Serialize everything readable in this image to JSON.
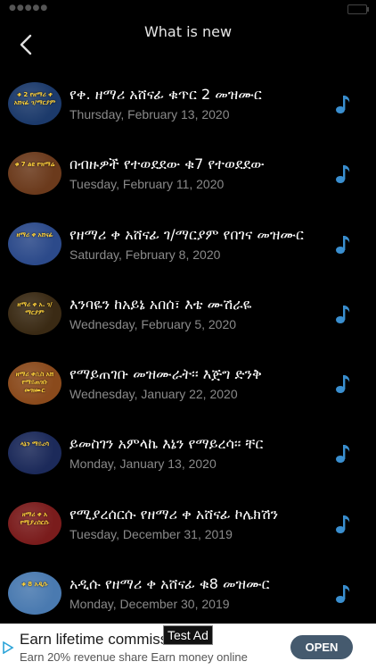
{
  "header": {
    "title": "What is new"
  },
  "items": [
    {
      "title": "የቀ. ዘማሪ አሸናፊ ቁጥር 2 መዝሙር",
      "date": "Thursday, February 13, 2020",
      "thumb_text": "ቁ 2 የዘማሪ ቀ አሸናፊ ገ/ማርያም",
      "thumb_bg": "#1c3a6b"
    },
    {
      "title": "በብዙዎች የተወደደው ቁ7 የተወደደው",
      "date": "Tuesday, February 11, 2020",
      "thumb_text": "ቁ 7 ልዩ የዝማሬ",
      "thumb_bg": "#6b3a1c"
    },
    {
      "title": "የዘማሪ ቀ አሸናፊ ገ/ማርያም የበገና መዝሙር",
      "date": "Saturday, February 8, 2020",
      "thumb_text": "ዘማሪ ቀ አሸናፊ",
      "thumb_bg": "#2c4a8a"
    },
    {
      "title": "እንባዬን ከአይኔ አበሰ፣ እቴ ሙሽራዬ",
      "date": "Wednesday, February 5, 2020",
      "thumb_text": "ዘማሪ ቀ አ. ገ/ማርያም",
      "thumb_bg": "#3a2a14"
    },
    {
      "title": "የማይጠገቡ መዝሙራት፡፡ እጅግ ድንቅ",
      "date": "Wednesday, January 22, 2020",
      "thumb_text": "ዘማሪ ቀሲስ አሸ የማይጠገቡ መዝሙር",
      "thumb_bg": "#8a4a1c"
    },
    {
      "title": "ይመስገን አምላኬ እኔን የማይረሳ፡፡ ቸር",
      "date": "Monday, January 13, 2020",
      "thumb_text": "ላኔን ማይረሳ",
      "thumb_bg": "#1c2a5a"
    },
    {
      "title": "የሚያረሰርሱ የዘማሪ ቀ አሸናፊ ኮሌክሽን",
      "date": "Tuesday, December 31, 2019",
      "thumb_text": "ዘማሪ ቀ አ የሚያረሰርሱ",
      "thumb_bg": "#7a1c1c"
    },
    {
      "title": "አዲሱ የዘማሪ ቀ አሸናፊ ቁ8 መዝሙር",
      "date": "Monday, December 30, 2019",
      "thumb_text": "ቁ 8 አዲሱ",
      "thumb_bg": "#4a7ab0"
    }
  ],
  "ad": {
    "headline": "Earn lifetime commiss",
    "badge": "Test Ad",
    "body": "Earn 20% revenue share Earn money online",
    "cta": "OPEN"
  },
  "colors": {
    "background": "#000000",
    "accent_icon": "#3a8fd0",
    "date_text": "#8a8a8a",
    "open_button": "#455a6e"
  },
  "icons": {
    "back": "chevron-left-icon",
    "item": "music-note-icon",
    "ad": "ad-choices-icon"
  }
}
